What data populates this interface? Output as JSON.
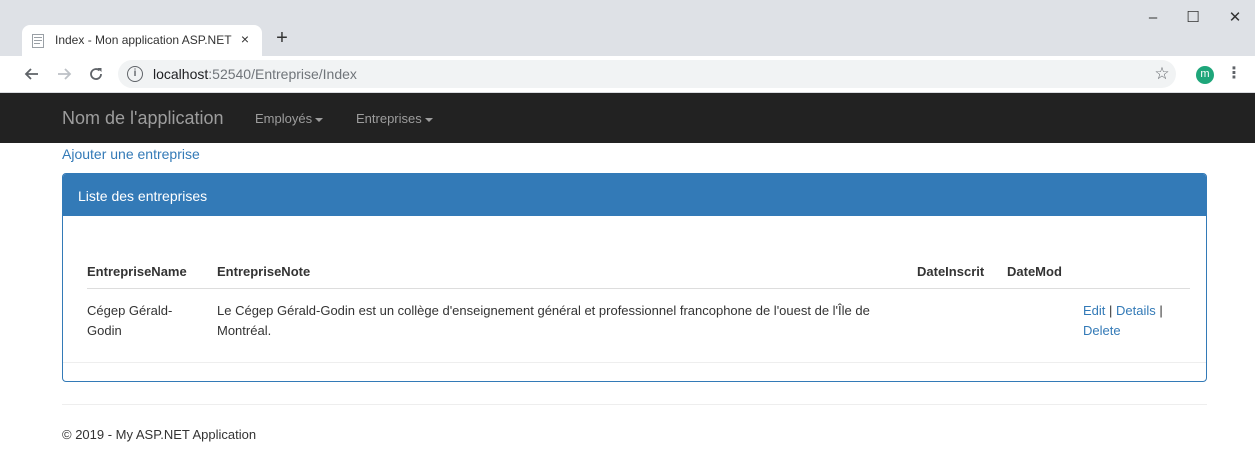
{
  "browser": {
    "tab_title": "Index - Mon application ASP.NET",
    "tab_close": "×",
    "new_tab": "+",
    "url_host": "localhost",
    "url_path": ":52540/Entreprise/Index",
    "avatar_letter": "m",
    "window_controls": {
      "minimize": "–",
      "maximize": "☐",
      "close": "✕"
    },
    "icons": {
      "back": "back-arrow-icon",
      "forward": "forward-arrow-icon",
      "reload": "reload-icon",
      "info": "info-icon",
      "bookmark": "star-icon",
      "menu": "kebab-menu-icon",
      "favicon": "page-icon"
    }
  },
  "navbar": {
    "brand": "Nom de l'application",
    "menus": [
      {
        "label": "Employés"
      },
      {
        "label": "Entreprises"
      }
    ],
    "background": "#222222"
  },
  "content": {
    "add_link": "Ajouter une entreprise",
    "panel": {
      "title": "Liste des entreprises",
      "header_color": "#337ab7",
      "columns": [
        "EntrepriseName",
        "EntrepriseNote",
        "DateInscrit",
        "DateMod"
      ],
      "rows": [
        {
          "name": "Cégep Gérald-Godin",
          "note": "Le Cégep Gérald-Godin est un collège d'enseignement général et professionnel francophone de l'ouest de l'Île de Montréal.",
          "date_inscrit": "",
          "date_mod": "",
          "actions": {
            "edit": "Edit",
            "details": "Details",
            "delete": "Delete",
            "separator": "|"
          }
        }
      ]
    }
  },
  "footer": {
    "text": "© 2019 - My ASP.NET Application"
  }
}
